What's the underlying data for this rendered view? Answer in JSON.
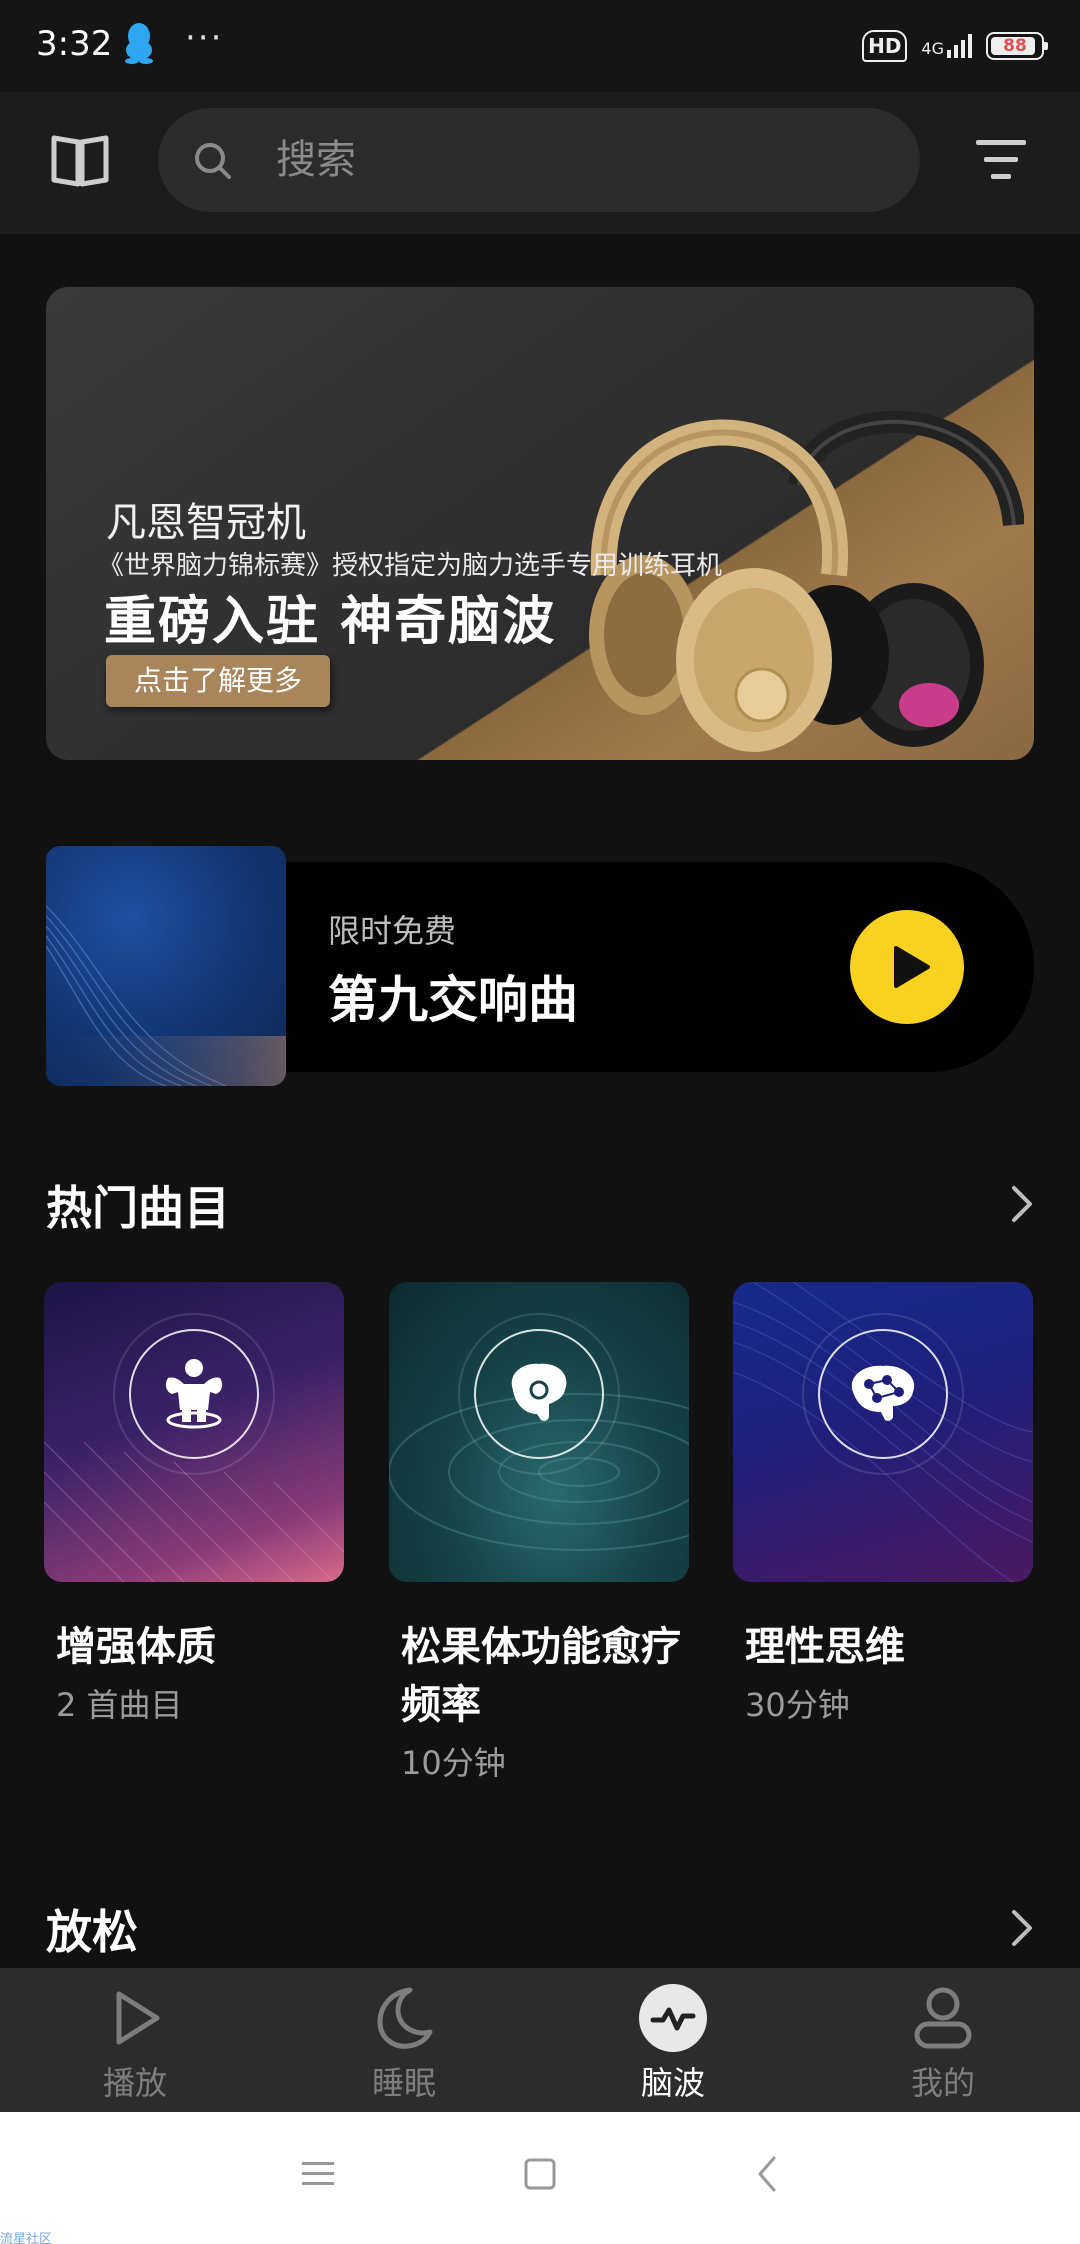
{
  "status_bar": {
    "time": "3:32",
    "dots": "···",
    "hd": "HD",
    "network": "4G",
    "battery": "88"
  },
  "header": {
    "search_placeholder": "搜索"
  },
  "banner": {
    "brand": "凡恩智冠机",
    "subtitle": "《世界脑力锦标赛》授权指定为脑力选手专用训练耳机",
    "title": "重磅入驻 神奇脑波",
    "button": "点击了解更多"
  },
  "promo": {
    "label": "限时免费",
    "title": "第九交响曲"
  },
  "sections": {
    "hot": "热门曲目",
    "relax": "放松"
  },
  "cards": [
    {
      "title": "增强体质",
      "meta": "2 首曲目",
      "icon": "muscle-icon"
    },
    {
      "title": "松果体功能愈疗频率",
      "meta": "10分钟",
      "icon": "brain-icon"
    },
    {
      "title": "理性思维",
      "meta": "30分钟",
      "icon": "brain-network-icon"
    }
  ],
  "bottom_nav": [
    {
      "label": "播放",
      "icon": "play-icon",
      "active": false
    },
    {
      "label": "睡眠",
      "icon": "moon-icon",
      "active": false
    },
    {
      "label": "脑波",
      "icon": "wave-icon",
      "active": true
    },
    {
      "label": "我的",
      "icon": "user-icon",
      "active": false
    }
  ],
  "watermark": "流星社区",
  "colors": {
    "background": "#111111",
    "accent_yellow": "#f8d21f",
    "banner_gold": "#a8855a",
    "nav_bg": "#2c2c2c"
  }
}
